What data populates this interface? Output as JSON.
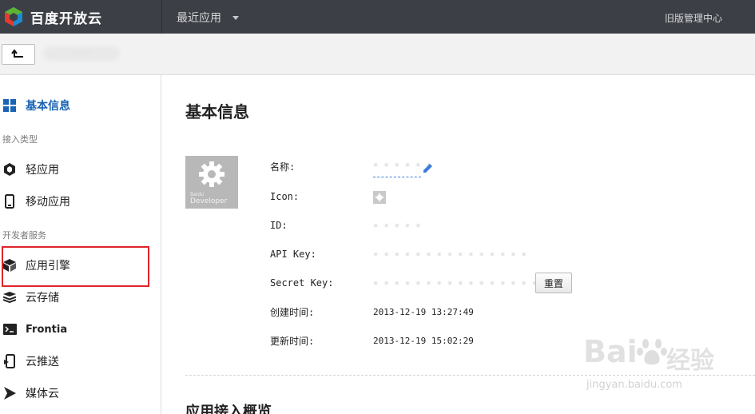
{
  "header": {
    "brand": "百度开放云",
    "recent_apps": "最近应用",
    "old_console": "旧版管理中心"
  },
  "subbar": {
    "app_name": "· · · ·"
  },
  "sidebar": {
    "basic_info": "基本信息",
    "group_access": "接入类型",
    "light_app": "轻应用",
    "mobile_app": "移动应用",
    "group_dev": "开发者服务",
    "app_engine": "应用引擎",
    "cloud_storage": "云存储",
    "frontia": "Frontia",
    "cloud_push": "云推送",
    "media_cloud": "媒体云"
  },
  "main": {
    "title": "基本信息",
    "icon_small_text": "Baidu",
    "icon_text": "Developer",
    "labels": {
      "name": "名称:",
      "icon": "Icon:",
      "id": "ID:",
      "api_key": "API Key:",
      "secret_key": "Secret Key:",
      "created": "创建时间:",
      "updated": "更新时间:"
    },
    "values": {
      "name": "· · · · · ·",
      "id": "· · · · ·",
      "api_key": "· · · · · · · · · ·  · · · · ·",
      "secret_key": "· · · · · · · · · · · · · · · · ·",
      "created": "2013-12-19 13:27:49",
      "updated": "2013-12-19 15:02:29"
    },
    "reset_button": "重置",
    "section_overview": "应用接入概览"
  },
  "watermark": {
    "logo_text": "Bai",
    "logo_cn": "经验",
    "url": "jingyan.baidu.com"
  },
  "colors": {
    "topbar": "#3c3f46",
    "active_blue": "#1a62b4",
    "highlight_red": "#e0242a"
  }
}
